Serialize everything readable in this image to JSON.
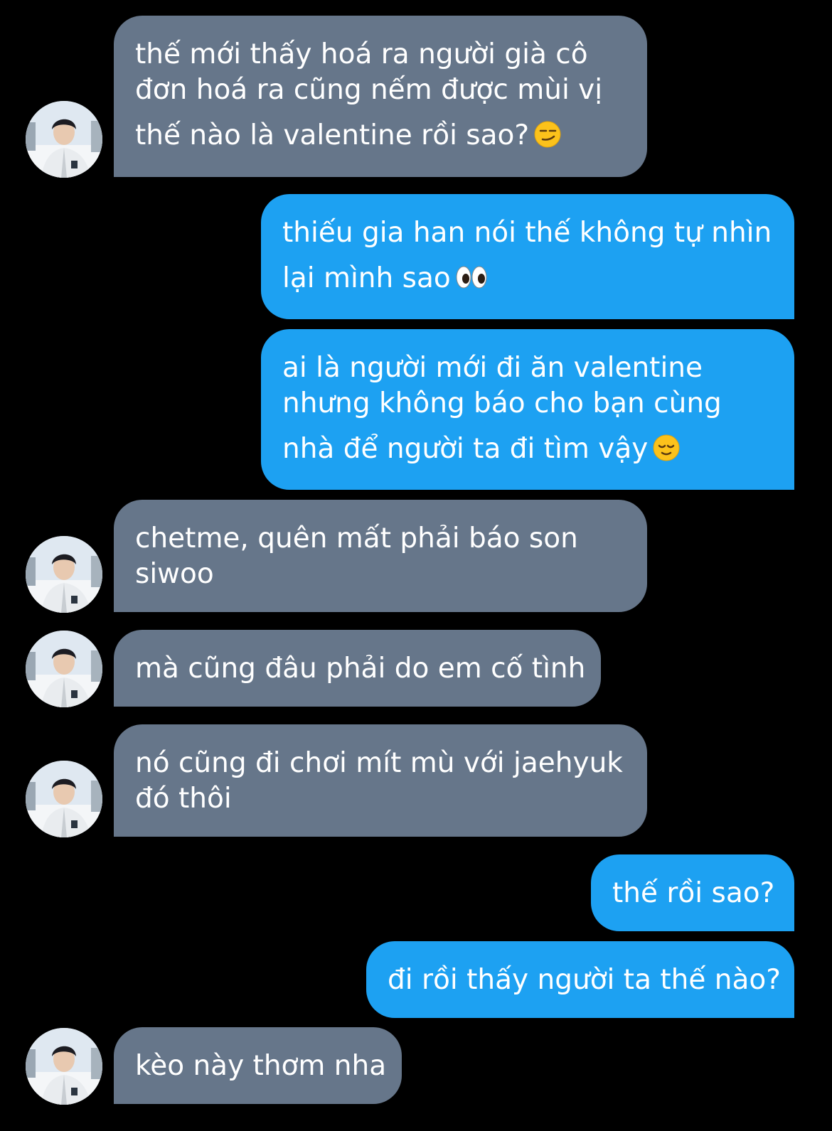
{
  "messages": [
    {
      "side": "received",
      "lines": [
        "thế mới thấy hoá ra người già cô",
        "đơn hoá ra cũng nếm được mùi vị",
        "thế nào là valentine rồi sao?"
      ],
      "emoji": "smirk-emoji"
    },
    {
      "side": "sent",
      "lines": [
        "thiếu gia han nói thế không tự nhìn",
        "lại mình sao"
      ],
      "emoji": "eyes-emoji"
    },
    {
      "side": "sent",
      "lines": [
        "ai là người mới đi ăn valentine",
        "nhưng không báo cho bạn cùng",
        "nhà để người ta đi tìm vậy"
      ],
      "emoji": "relieved-emoji"
    },
    {
      "side": "received",
      "lines": [
        "chetme, quên mất phải báo son",
        "siwoo"
      ]
    },
    {
      "side": "received",
      "lines": [
        "mà cũng đâu phải do em cố tình"
      ]
    },
    {
      "side": "received",
      "lines": [
        "nó cũng đi chơi mít mù với jaehyuk",
        "đó thôi"
      ]
    },
    {
      "side": "sent",
      "lines": [
        "thế rồi sao?"
      ]
    },
    {
      "side": "sent",
      "lines": [
        "đi rồi thấy người ta thế nào?"
      ]
    },
    {
      "side": "received",
      "lines": [
        "kèo này thơm nha"
      ]
    }
  ],
  "colors": {
    "background": "#000000",
    "received_bubble": "#66768a",
    "sent_bubble": "#1da1f2",
    "text": "#ffffff"
  },
  "avatar": {
    "icon": "user-avatar-photo"
  }
}
